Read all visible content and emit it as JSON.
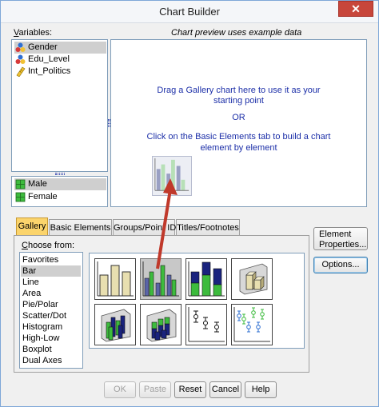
{
  "window": {
    "title": "Chart Builder",
    "close_label": "✕"
  },
  "variables": {
    "label": "Variables:",
    "items": [
      {
        "name": "Gender",
        "icon": "nominal-variable-icon",
        "selected": true
      },
      {
        "name": "Edu_Level",
        "icon": "nominal-variable-icon",
        "selected": false
      },
      {
        "name": "Int_Politics",
        "icon": "scale-variable-icon",
        "selected": false
      }
    ]
  },
  "categories": {
    "items": [
      {
        "name": "Male",
        "selected": true
      },
      {
        "name": "Female",
        "selected": false
      }
    ]
  },
  "preview": {
    "header": "Chart preview uses example data",
    "line1": "Drag a Gallery chart here to use it as your",
    "line2": "starting point",
    "or": "OR",
    "line3": "Click on the Basic Elements tab to build a chart",
    "line4": "element by element"
  },
  "tabs": [
    {
      "label": "Gallery",
      "active": true
    },
    {
      "label": "Basic Elements",
      "active": false
    },
    {
      "label": "Groups/Point ID",
      "active": false
    },
    {
      "label": "Titles/Footnotes",
      "active": false
    }
  ],
  "gallery": {
    "choose_label": "Choose from:",
    "chart_types": [
      {
        "label": "Favorites",
        "selected": false
      },
      {
        "label": "Bar",
        "selected": true
      },
      {
        "label": "Line",
        "selected": false
      },
      {
        "label": "Area",
        "selected": false
      },
      {
        "label": "Pie/Polar",
        "selected": false
      },
      {
        "label": "Scatter/Dot",
        "selected": false
      },
      {
        "label": "Histogram",
        "selected": false
      },
      {
        "label": "High-Low",
        "selected": false
      },
      {
        "label": "Boxplot",
        "selected": false
      },
      {
        "label": "Dual Axes",
        "selected": false
      }
    ]
  },
  "side_buttons": {
    "element_properties_line1": "Element",
    "element_properties_line2": "Properties...",
    "options": "Options..."
  },
  "bottom_buttons": {
    "ok": "OK",
    "paste": "Paste",
    "reset": "Reset",
    "cancel": "Cancel",
    "help": "Help"
  },
  "colors": {
    "accent_tab": "#fbd46c",
    "preview_text": "#1c2fa8",
    "drag_arrow": "#c0392b",
    "bar_tan": "#e8dfb0",
    "bar_green": "#3dbb3d",
    "bar_navy": "#1a237e"
  }
}
